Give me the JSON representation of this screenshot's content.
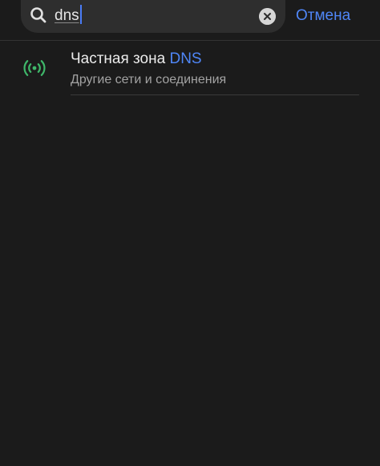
{
  "search": {
    "query": "dns",
    "cancel_label": "Отмена",
    "search_icon": "search-icon",
    "clear_icon": "clear-icon"
  },
  "results": [
    {
      "title_prefix": "Частная зона ",
      "title_highlight": "DNS",
      "subtitle": "Другие сети и соединения",
      "icon": "antenna-icon",
      "icon_color": "#3fb86a"
    }
  ],
  "colors": {
    "background": "#1b1b1b",
    "accent": "#4f86f7",
    "search_field": "#2e2e2e"
  }
}
